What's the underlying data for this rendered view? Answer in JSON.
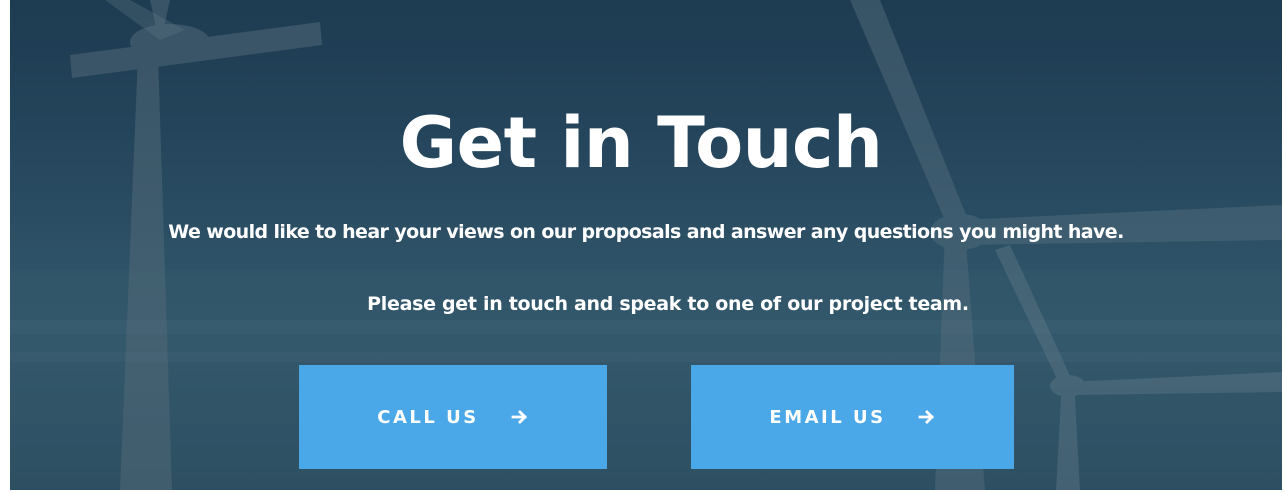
{
  "hero": {
    "title": "Get in Touch",
    "subtitle_1": "We would like to hear your views on our proposals and answer any questions you might have.",
    "subtitle_2": "Please get in touch and speak to one of our project team."
  },
  "buttons": {
    "call_label": "CALL US",
    "email_label": "EMAIL US",
    "icon": "arrow-right-icon"
  },
  "colors": {
    "button_bg": "#4aa7e8",
    "text": "#ffffff",
    "background": "#2b4e66"
  }
}
